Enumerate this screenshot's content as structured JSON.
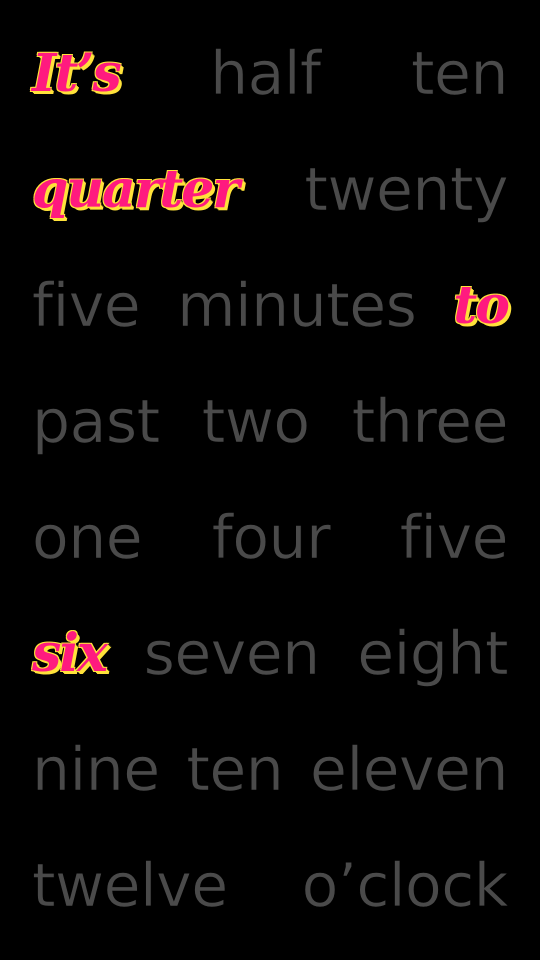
{
  "colors": {
    "background": "#000000",
    "inactive_word": "#4a4a4a",
    "active_word": "#ff1a7f",
    "active_outline": "#ffe23a"
  },
  "rows": [
    {
      "words": [
        {
          "text": "It’s",
          "active": true
        },
        {
          "text": "half",
          "active": false
        },
        {
          "text": "ten",
          "active": false
        }
      ]
    },
    {
      "words": [
        {
          "text": "quarter",
          "active": true
        },
        {
          "text": "twenty",
          "active": false
        }
      ]
    },
    {
      "words": [
        {
          "text": "five",
          "active": false
        },
        {
          "text": "minutes",
          "active": false
        },
        {
          "text": "to",
          "active": true
        }
      ]
    },
    {
      "words": [
        {
          "text": "past",
          "active": false
        },
        {
          "text": "two",
          "active": false
        },
        {
          "text": "three",
          "active": false
        }
      ]
    },
    {
      "words": [
        {
          "text": "one",
          "active": false
        },
        {
          "text": "four",
          "active": false
        },
        {
          "text": "five",
          "active": false
        }
      ]
    },
    {
      "words": [
        {
          "text": "six",
          "active": true
        },
        {
          "text": "seven",
          "active": false
        },
        {
          "text": "eight",
          "active": false
        }
      ]
    },
    {
      "words": [
        {
          "text": "nine",
          "active": false
        },
        {
          "text": "ten",
          "active": false
        },
        {
          "text": "eleven",
          "active": false
        }
      ]
    },
    {
      "words": [
        {
          "text": "twelve",
          "active": false
        },
        {
          "text": "o’clock",
          "active": false
        }
      ]
    }
  ]
}
